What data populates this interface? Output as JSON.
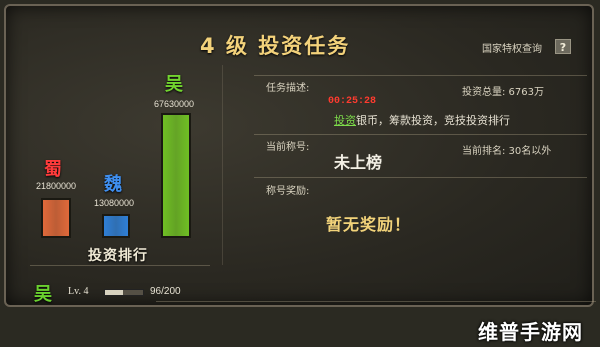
{
  "header": {
    "title": "4 级   投资任务",
    "query_link": "国家特权查询",
    "help_label": "?"
  },
  "ranking": {
    "title": "投资排行",
    "kingdoms": [
      {
        "name": "蜀",
        "amount": "21800000",
        "value": 21800000,
        "color": "#e0693a",
        "text_color": "#ff3b3b"
      },
      {
        "name": "魏",
        "amount": "13080000",
        "value": 13080000,
        "color": "#2f7fd6",
        "text_color": "#3f8ff0"
      },
      {
        "name": "吴",
        "amount": "67630000",
        "value": 67630000,
        "color": "#6fbf24",
        "text_color": "#72d52f"
      }
    ]
  },
  "task": {
    "desc_label": "任务描述:",
    "total_label": "投资总量: 6763万",
    "timer": "00:25:28",
    "desc_link": "投资",
    "desc_rest": "银币，筹款投资，竞技投资排行"
  },
  "title_info": {
    "label": "当前称号:",
    "value": "未上榜",
    "rank_label": "当前排名: 30名以外"
  },
  "reward": {
    "label": "称号奖励:",
    "value": "暂无奖励！"
  },
  "player": {
    "kingdom": "吴",
    "level": "Lv. 4",
    "exp_text": "96/200",
    "exp_fraction": 0.48
  },
  "watermark": "维普手游网",
  "colors": {
    "gold": "#f3d27b",
    "green": "#7ddc4a",
    "red": "#ff3b2f"
  }
}
